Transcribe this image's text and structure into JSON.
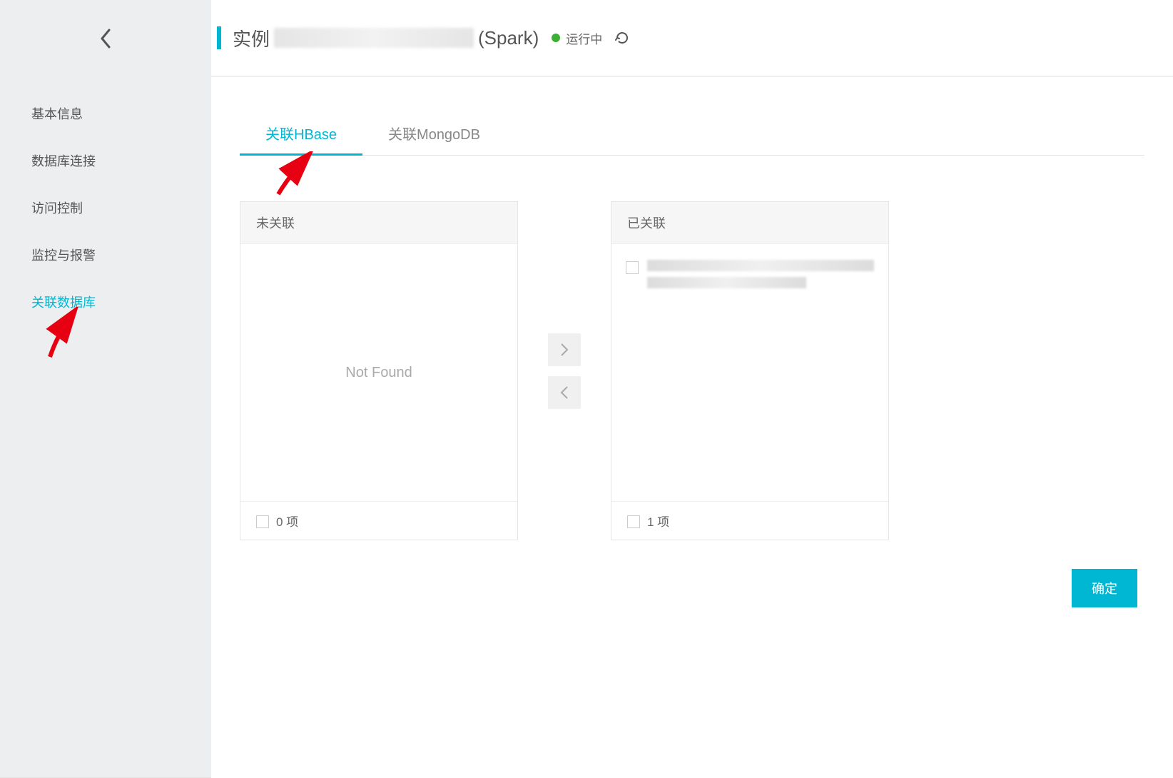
{
  "sidebar": {
    "items": [
      {
        "label": "基本信息"
      },
      {
        "label": "数据库连接"
      },
      {
        "label": "访问控制"
      },
      {
        "label": "监控与报警"
      },
      {
        "label": "关联数据库"
      }
    ]
  },
  "header": {
    "title_prefix": "实例",
    "title_suffix": "(Spark)",
    "status_text": "运行中"
  },
  "tabs": [
    {
      "label": "关联HBase"
    },
    {
      "label": "关联MongoDB"
    }
  ],
  "transfer": {
    "left": {
      "title": "未关联",
      "empty_text": "Not Found",
      "footer_count": "0 项"
    },
    "right": {
      "title": "已关联",
      "footer_count": "1 项"
    }
  },
  "confirm_label": "确定"
}
